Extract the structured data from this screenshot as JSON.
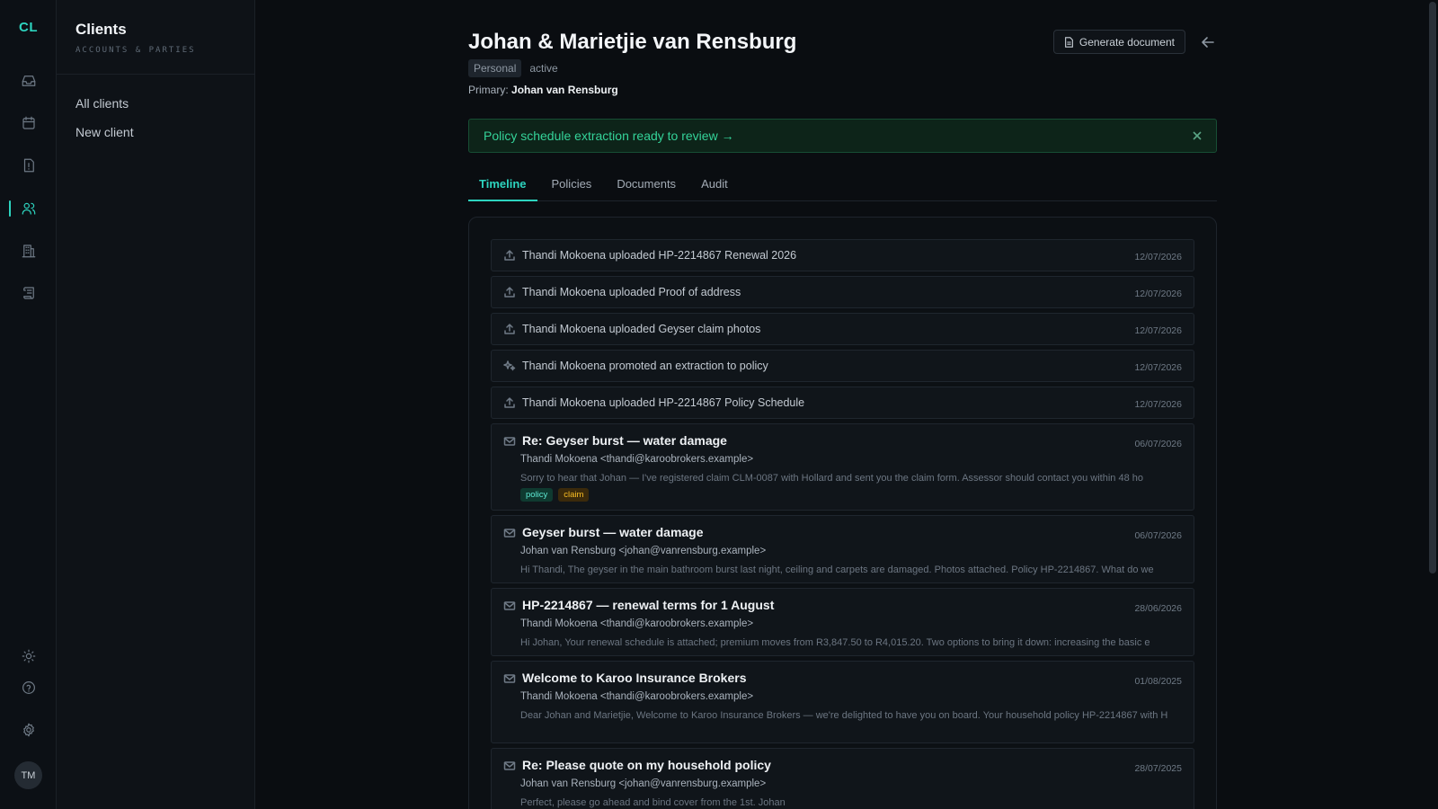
{
  "app": {
    "logo": "CL",
    "avatar_initials": "TM"
  },
  "rail": {
    "items": [
      {
        "icon": "inbox-icon"
      },
      {
        "icon": "calendar-icon"
      },
      {
        "icon": "alert-file-icon"
      },
      {
        "icon": "users-icon",
        "active": true
      },
      {
        "icon": "building-icon"
      },
      {
        "icon": "scroll-icon"
      }
    ],
    "bottom": [
      {
        "icon": "sun-icon"
      },
      {
        "icon": "help-icon"
      },
      {
        "icon": "gear-icon"
      }
    ]
  },
  "section": {
    "title": "Clients",
    "subtitle": "ACCOUNTS & PARTIES",
    "nav": [
      {
        "label": "All clients"
      },
      {
        "label": "New client"
      }
    ]
  },
  "client": {
    "name": "Johan & Marietjie van Rensburg",
    "type": "Personal",
    "status": "active",
    "primary_label": "Primary:",
    "primary_name": "Johan van Rensburg",
    "generate_label": "Generate document"
  },
  "banner": {
    "text": "Policy schedule extraction ready to review →"
  },
  "tabs": [
    {
      "label": "Timeline",
      "active": true
    },
    {
      "label": "Policies"
    },
    {
      "label": "Documents"
    },
    {
      "label": "Audit"
    }
  ],
  "events": [
    {
      "kind": "upload",
      "text": "Thandi Mokoena uploaded HP-2214867 Renewal 2026",
      "date": "12/07/2026"
    },
    {
      "kind": "upload",
      "text": "Thandi Mokoena uploaded Proof of address",
      "date": "12/07/2026"
    },
    {
      "kind": "upload",
      "text": "Thandi Mokoena uploaded Geyser claim photos",
      "date": "12/07/2026"
    },
    {
      "kind": "promote",
      "text": "Thandi Mokoena promoted an extraction to policy",
      "date": "12/07/2026"
    },
    {
      "kind": "upload",
      "text": "Thandi Mokoena uploaded HP-2214867 Policy Schedule",
      "date": "12/07/2026"
    }
  ],
  "emails": [
    {
      "subject": "Re: Geyser burst — water damage",
      "from": "Thandi Mokoena <thandi@karoobrokers.example>",
      "snippet": "Sorry to hear that Johan — I've registered claim CLM-0087 with Hollard and sent you the claim form. Assessor should contact you within 48 ho",
      "date": "06/07/2026",
      "labels": [
        "policy",
        "claim"
      ]
    },
    {
      "subject": "Geyser burst — water damage",
      "from": "Johan van Rensburg <johan@vanrensburg.example>",
      "snippet": "Hi Thandi, The geyser in the main bathroom burst last night, ceiling and carpets are damaged. Photos attached. Policy HP-2214867. What do we",
      "date": "06/07/2026",
      "labels": []
    },
    {
      "subject": "HP-2214867 — renewal terms for 1 August",
      "from": "Thandi Mokoena <thandi@karoobrokers.example>",
      "snippet": "Hi Johan, Your renewal schedule is attached; premium moves from R3,847.50 to R4,015.20. Two options to bring it down: increasing the basic e",
      "date": "28/06/2026",
      "labels": []
    },
    {
      "subject": "Welcome to Karoo Insurance Brokers",
      "from": "Thandi Mokoena <thandi@karoobrokers.example>",
      "snippet": "Dear Johan and Marietjie, Welcome to Karoo Insurance Brokers — we're delighted to have you on board. Your household policy HP-2214867 with H",
      "date": "01/08/2025",
      "labels": []
    },
    {
      "subject": "Re: Please quote on my household policy",
      "from": "Johan van Rensburg <johan@vanrensburg.example>",
      "snippet": "Perfect, please go ahead and bind cover from the 1st. Johan",
      "date": "28/07/2025",
      "labels": []
    }
  ]
}
